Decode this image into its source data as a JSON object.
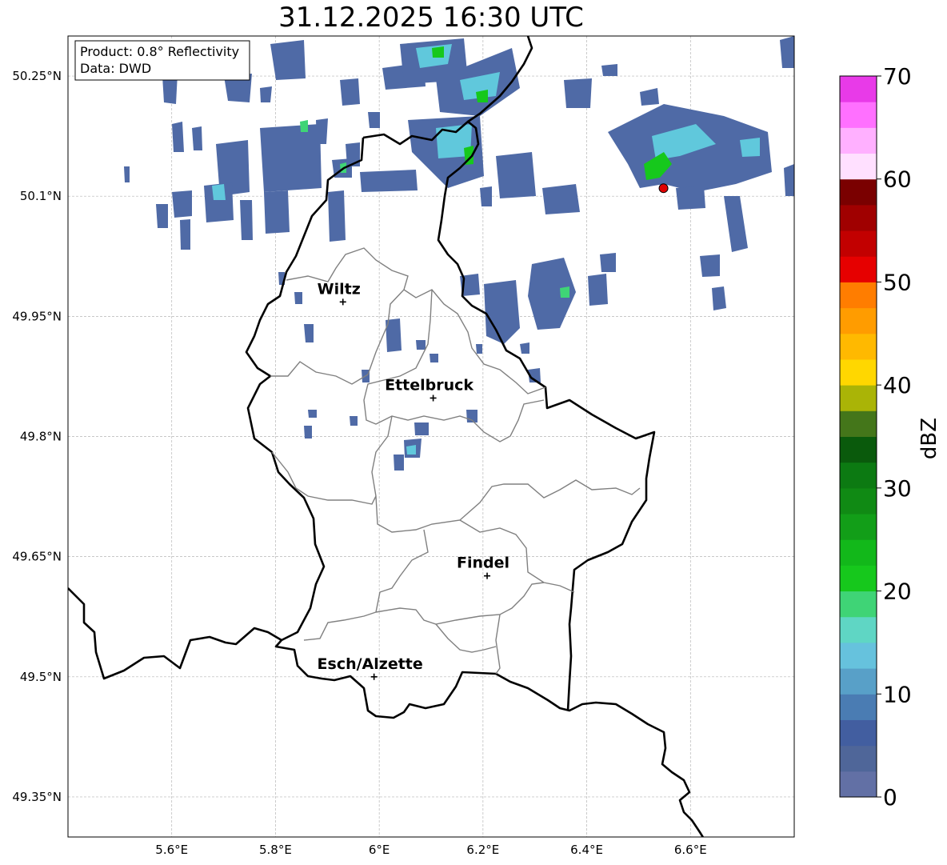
{
  "title": "31.12.2025 16:30 UTC",
  "info_box": {
    "line1": "Product: 0.8° Reflectivity",
    "line2": "Data: DWD"
  },
  "map": {
    "lon_range": [
      5.4,
      6.8
    ],
    "lat_range": [
      49.3,
      50.3
    ],
    "x_ticks": [
      {
        "value": 5.6,
        "label": "5.6°E"
      },
      {
        "value": 5.8,
        "label": "5.8°E"
      },
      {
        "value": 6.0,
        "label": "6°E"
      },
      {
        "value": 6.2,
        "label": "6.2°E"
      },
      {
        "value": 6.4,
        "label": "6.4°E"
      },
      {
        "value": 6.6,
        "label": "6.6°E"
      }
    ],
    "y_ticks": [
      {
        "value": 50.25,
        "label": "50.25°N"
      },
      {
        "value": 50.1,
        "label": "50.1°N"
      },
      {
        "value": 49.95,
        "label": "49.95°N"
      },
      {
        "value": 49.8,
        "label": "49.8°N"
      },
      {
        "value": 49.65,
        "label": "49.65°N"
      },
      {
        "value": 49.5,
        "label": "49.5°N"
      },
      {
        "value": 49.35,
        "label": "49.35°N"
      }
    ],
    "grid": true,
    "cities": [
      {
        "name": "Wiltz",
        "lon": 5.93,
        "lat": 49.968
      },
      {
        "name": "Ettelbruck",
        "lon": 6.104,
        "lat": 49.848
      },
      {
        "name": "Findel",
        "lon": 6.208,
        "lat": 49.626
      },
      {
        "name": "Esch/Alzette",
        "lon": 5.99,
        "lat": 49.5
      }
    ],
    "radar_site": {
      "lon": 6.548,
      "lat": 50.11,
      "color": "#e00000"
    }
  },
  "colorbar": {
    "label": "dBZ",
    "min": 0,
    "max": 70,
    "tick_labels": [
      "0",
      "10",
      "20",
      "30",
      "40",
      "50",
      "60",
      "70"
    ],
    "colors": [
      "#6270a5",
      "#4f6699",
      "#425ea0",
      "#4a7cb3",
      "#58a0c8",
      "#66c2dd",
      "#5fd6c4",
      "#3fd476",
      "#16c81c",
      "#12b81a",
      "#129e18",
      "#108a14",
      "#0c7a12",
      "#0a5a0c",
      "#44761a",
      "#aab406",
      "#ffd700",
      "#ffb900",
      "#ff9c00",
      "#ff7d00",
      "#e60000",
      "#c20000",
      "#a00000",
      "#7a0000",
      "#ffe0ff",
      "#ffb0ff",
      "#ff70ff",
      "#e83ae8"
    ]
  }
}
